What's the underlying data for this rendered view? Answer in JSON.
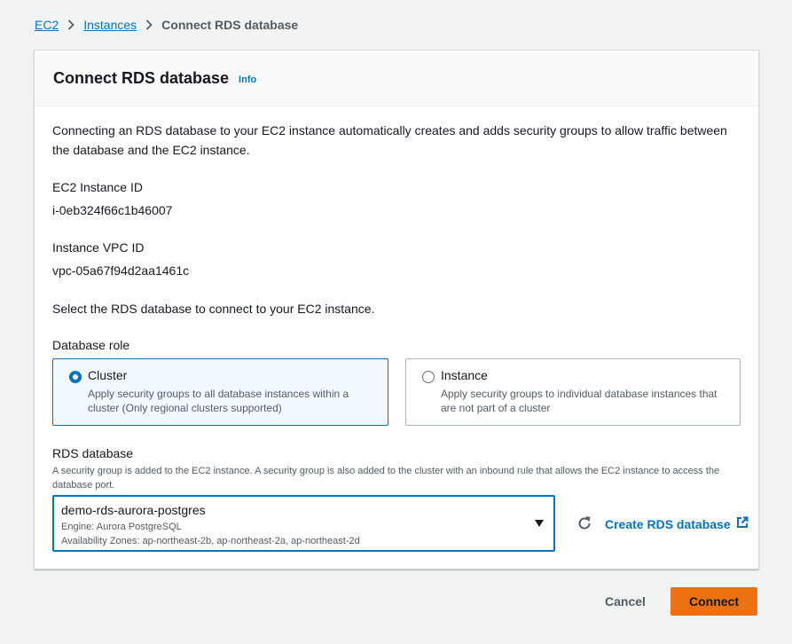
{
  "breadcrumb": {
    "items": [
      {
        "label": "EC2"
      },
      {
        "label": "Instances"
      }
    ],
    "current": "Connect RDS database"
  },
  "panel": {
    "title": "Connect RDS database",
    "info_label": "Info",
    "intro": "Connecting an RDS database to your EC2 instance automatically creates and adds security groups to allow traffic between the database and the EC2 instance.",
    "instance_id_label": "EC2 Instance ID",
    "instance_id_value": "i-0eb324f66c1b46007",
    "vpc_id_label": "Instance VPC ID",
    "vpc_id_value": "vpc-05a67f94d2aa1461c",
    "select_prompt": "Select the RDS database to connect to your EC2 instance.",
    "role": {
      "label": "Database role",
      "selected": "cluster",
      "options": [
        {
          "id": "cluster",
          "title": "Cluster",
          "description": "Apply security groups to all database instances within a cluster (Only regional clusters supported)"
        },
        {
          "id": "instance",
          "title": "Instance",
          "description": "Apply security groups to individual database instances that are not part of a cluster"
        }
      ]
    },
    "rds": {
      "label": "RDS database",
      "description": "A security group is added to the EC2 instance. A security group is also added to the cluster with an inbound rule that allows the EC2 instance to access the database port.",
      "selected_name": "demo-rds-aurora-postgres",
      "selected_engine": "Engine: Aurora PostgreSQL",
      "selected_azs": "Availability Zones: ap-northeast-2b, ap-northeast-2a, ap-northeast-2d",
      "create_link": "Create RDS database"
    }
  },
  "footer": {
    "cancel_label": "Cancel",
    "connect_label": "Connect"
  },
  "colors": {
    "link": "#0073bb",
    "primary_button": "#ec7211",
    "page_background": "#f2f3f3"
  },
  "icons": [
    "chevron-right-icon",
    "radio-selected-icon",
    "radio-unselected-icon",
    "dropdown-caret-icon",
    "refresh-icon",
    "external-link-icon"
  ]
}
